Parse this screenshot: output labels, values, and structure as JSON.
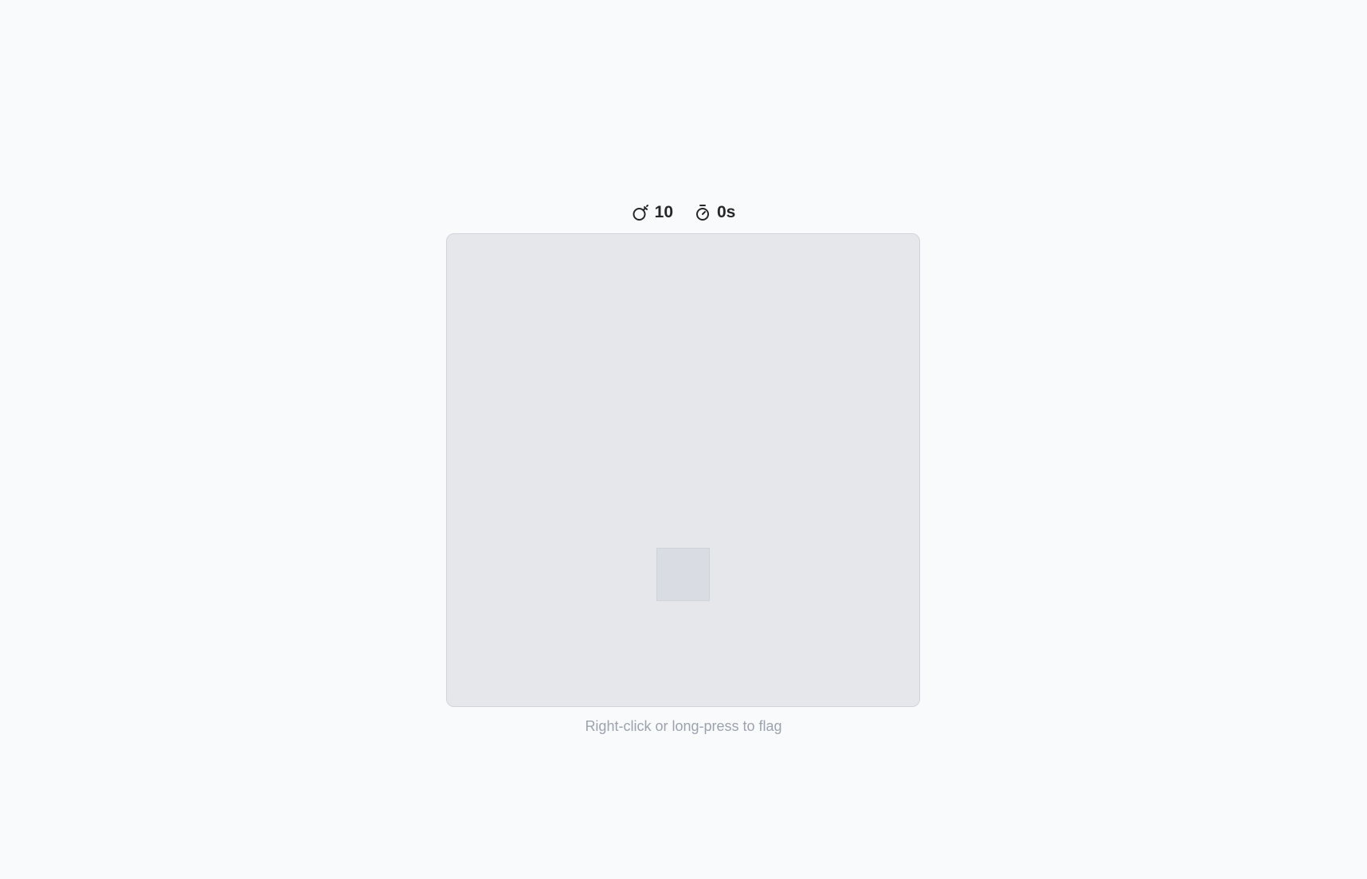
{
  "stats": {
    "mines_icon": "bomb-icon",
    "mines_remaining": "10",
    "timer_icon": "stopwatch-icon",
    "elapsed": "0s"
  },
  "board": {
    "rows": 9,
    "cols": 9,
    "hovered_cell": {
      "row": 6,
      "col": 4
    },
    "colors": {
      "board_bg": "#e5e7eb",
      "hover_cell": "#d9dce2",
      "page_bg": "#f9fafb"
    }
  },
  "hint": {
    "text": "Right-click or long-press to flag"
  }
}
